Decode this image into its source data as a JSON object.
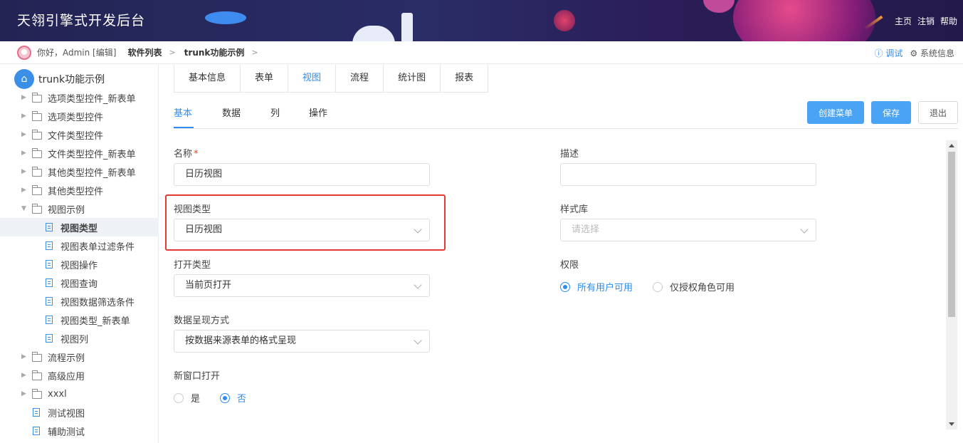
{
  "app": {
    "title": "天翎引擎式开发后台",
    "links": [
      "主页",
      "注销",
      "帮助"
    ]
  },
  "breadcrumb": {
    "greeting": "你好，Admin [编辑]",
    "items": [
      "软件列表",
      "trunk功能示例"
    ],
    "debug": "ⓘ 调试",
    "sysinfo": "⚙ 系统信息"
  },
  "sidebar": {
    "root": "trunk功能示例",
    "items": [
      {
        "label": "选项类型控件_新表单",
        "type": "folder"
      },
      {
        "label": "选项类型控件",
        "type": "folder"
      },
      {
        "label": "文件类型控件",
        "type": "folder"
      },
      {
        "label": "文件类型控件_新表单",
        "type": "folder"
      },
      {
        "label": "其他类型控件_新表单",
        "type": "folder"
      },
      {
        "label": "其他类型控件",
        "type": "folder"
      },
      {
        "label": "视图示例",
        "type": "folder-open"
      },
      {
        "label": "视图类型",
        "type": "doc",
        "selected": true
      },
      {
        "label": "视图表单过滤条件",
        "type": "doc"
      },
      {
        "label": "视图操作",
        "type": "doc"
      },
      {
        "label": "视图查询",
        "type": "doc"
      },
      {
        "label": "视图数据筛选条件",
        "type": "doc"
      },
      {
        "label": "视图类型_新表单",
        "type": "doc"
      },
      {
        "label": "视图列",
        "type": "doc"
      },
      {
        "label": "流程示例",
        "type": "folder"
      },
      {
        "label": "高级应用",
        "type": "folder"
      },
      {
        "label": "xxxl",
        "type": "folder"
      },
      {
        "label": "测试视图",
        "type": "doc-root"
      },
      {
        "label": "辅助测试",
        "type": "doc-root"
      }
    ]
  },
  "tabs": [
    "基本信息",
    "表单",
    "视图",
    "流程",
    "统计图",
    "报表"
  ],
  "active_tab": "视图",
  "subtabs": [
    "基本",
    "数据",
    "列",
    "操作"
  ],
  "buttons": {
    "create_menu": "创建菜单",
    "save": "保存",
    "exit": "退出"
  },
  "form": {
    "name_label": "名称",
    "name_required": "*",
    "name_value": "日历视图",
    "desc_label": "描述",
    "desc_value": "",
    "view_type_label": "视图类型",
    "view_type_value": "日历视图",
    "style_label": "样式库",
    "style_placeholder": "请选择",
    "open_type_label": "打开类型",
    "open_type_value": "当前页打开",
    "permission_label": "权限",
    "permission_options": [
      "所有用户可用",
      "仅授权角色可用"
    ],
    "display_label": "数据呈现方式",
    "display_value": "按数据来源表单的格式呈现",
    "new_window_label": "新窗口打开",
    "new_window_options": [
      "是",
      "否"
    ]
  },
  "colors": {
    "accent": "#2d8cf0",
    "header": "#2a2c66",
    "highlight": "#e53935"
  }
}
